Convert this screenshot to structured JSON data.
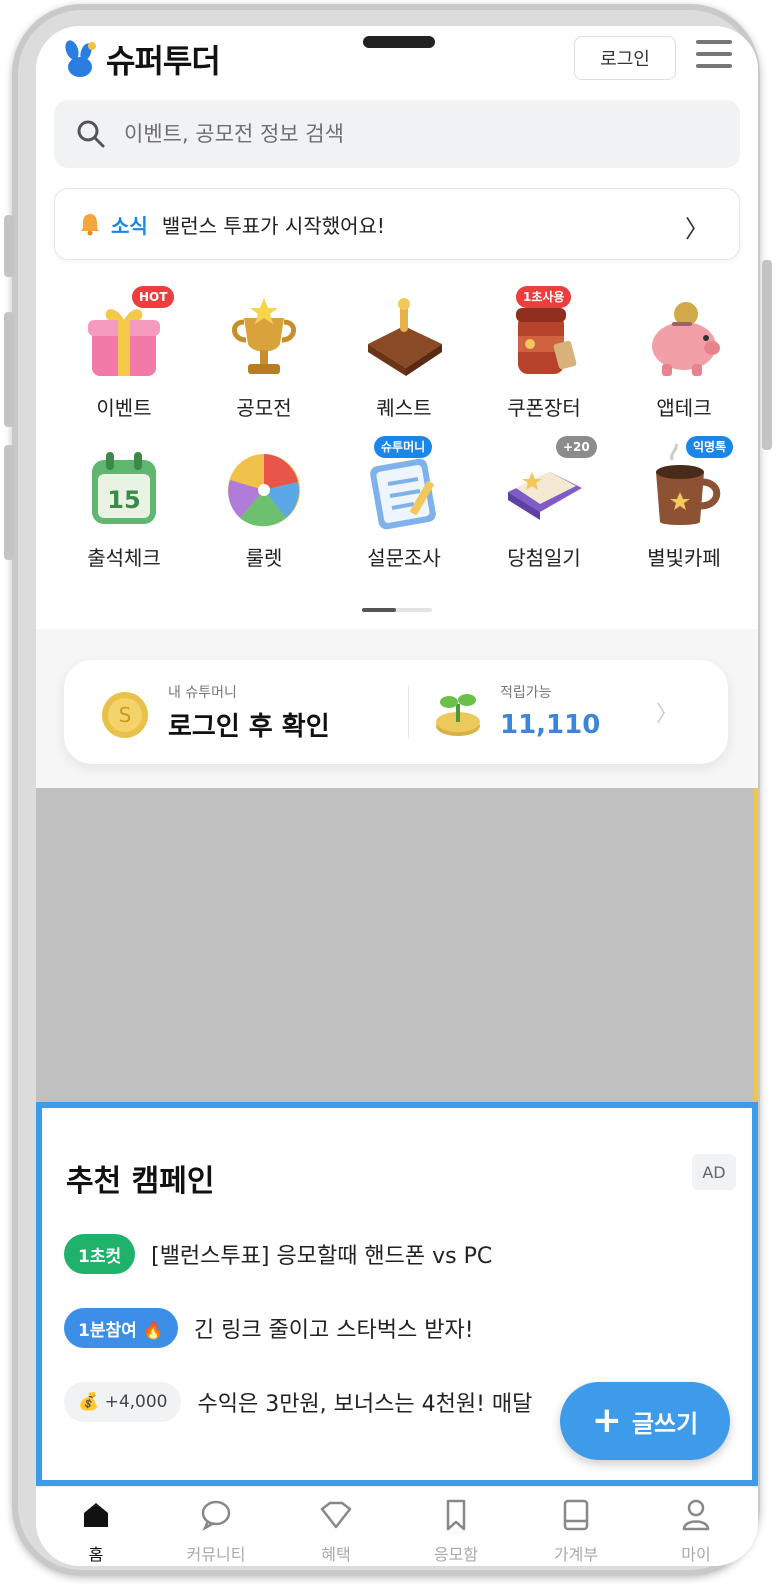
{
  "app": {
    "logo_text": "슈퍼투더"
  },
  "header": {
    "login_label": "로그인"
  },
  "search": {
    "placeholder": "이벤트, 공모전 정보 검색"
  },
  "notice": {
    "tag": "소식",
    "message": "밸런스 투표가 시작했어요!",
    "chevron": "〉"
  },
  "categories": [
    {
      "label": "이벤트",
      "badge": "HOT",
      "icon": "gift-icon"
    },
    {
      "label": "공모전",
      "badge": "",
      "icon": "trophy-icon"
    },
    {
      "label": "퀘스트",
      "badge": "",
      "icon": "wallet-icon"
    },
    {
      "label": "쿠폰장터",
      "badge": "1초사용",
      "icon": "coffee-cup-icon"
    },
    {
      "label": "앱테크",
      "badge": "",
      "icon": "piggy-bank-icon"
    },
    {
      "label": "출석체크",
      "badge": "",
      "icon": "calendar-icon"
    },
    {
      "label": "룰렛",
      "badge": "",
      "icon": "roulette-icon"
    },
    {
      "label": "설문조사",
      "badge": "슈투머니",
      "icon": "survey-icon"
    },
    {
      "label": "당첨일기",
      "badge": "+20",
      "icon": "diary-icon"
    },
    {
      "label": "별빛카페",
      "badge": "익명톡",
      "icon": "mug-icon"
    }
  ],
  "money": {
    "left_caption": "내 슈투머니",
    "left_value": "로그인 후 확인",
    "right_caption": "적립가능",
    "right_value": "11,110",
    "chevron": "〉"
  },
  "campaign": {
    "title": "추천 캠페인",
    "ad_label": "AD",
    "items": [
      {
        "pill": "1초컷",
        "text": "[밸런스투표] 응모할때 핸드폰 vs PC"
      },
      {
        "pill": "1분참여 🔥",
        "text": "긴 링크 줄이고 스타벅스 받자!"
      },
      {
        "pill": "💰 +4,000",
        "text": "수익은 3만원, 보너스는 4천원! 매달"
      }
    ]
  },
  "write_button": {
    "plus": "+",
    "label": "글쓰기"
  },
  "nav": [
    {
      "label": "홈",
      "icon": "home-icon"
    },
    {
      "label": "커뮤니티",
      "icon": "chat-bubble-icon"
    },
    {
      "label": "혜택",
      "icon": "heart-icon"
    },
    {
      "label": "응모함",
      "icon": "bookmark-icon"
    },
    {
      "label": "가계부",
      "icon": "ledger-icon"
    },
    {
      "label": "마이",
      "icon": "user-icon"
    }
  ],
  "colors": {
    "accent": "#3d9be9",
    "notice_tag": "#1a86e8",
    "green_pill": "#1fb26b",
    "ad_placeholder": "#c0c0c0"
  }
}
